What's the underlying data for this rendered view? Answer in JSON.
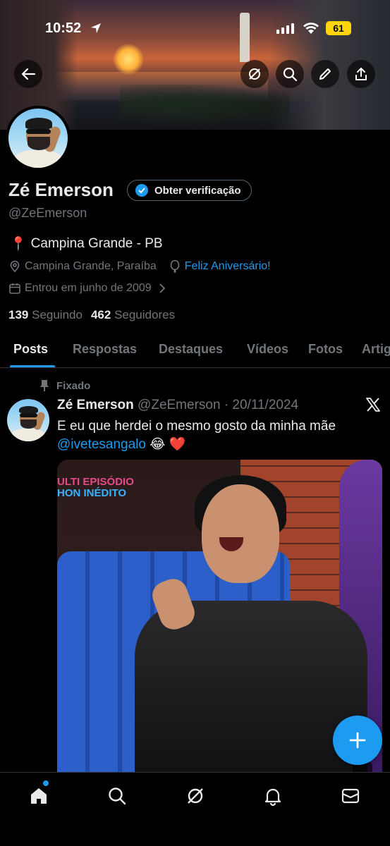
{
  "status_bar": {
    "time": "10:52",
    "battery": "61"
  },
  "profile": {
    "name": "Zé Emerson",
    "verify_label": "Obter verificação",
    "handle": "@ZeEmerson",
    "bio_emoji": "📍",
    "bio": "Campina Grande - PB",
    "location": "Campina Grande, Paraíba",
    "birthday": "Feliz Aniversário!",
    "joined": "Entrou em junho de 2009",
    "following_count": "139",
    "following_label": "Seguindo",
    "followers_count": "462",
    "followers_label": "Seguidores"
  },
  "tabs": [
    "Posts",
    "Respostas",
    "Destaques",
    "Vídeos",
    "Fotos",
    "Artigos"
  ],
  "active_tab": "Posts",
  "post": {
    "pinned_label": "Fixado",
    "author": "Zé Emerson",
    "handle_date": "@ZeEmerson · 20/11/2024",
    "text_line1": "E eu que herdei o mesmo gosto da minha mãe",
    "mention": "@ivetesangalo",
    "emojis": " 😂 ❤️",
    "media_tag_line1": "ULTI  EPISÓDIO",
    "media_tag_line2": "HON  INÉDITO"
  },
  "colors": {
    "accent": "#1d9bf0",
    "muted": "#71767b",
    "text": "#e7e9ea",
    "battery": "#ffd60a"
  },
  "icons": [
    "back-arrow-icon",
    "grok-icon",
    "search-icon",
    "edit-pen-icon",
    "share-icon",
    "verified-badge-icon",
    "location-pin-icon",
    "balloon-icon",
    "calendar-icon",
    "chevron-right-icon",
    "pin-icon",
    "x-logo-icon",
    "plus-icon",
    "home-icon",
    "search-icon",
    "grok-icon",
    "bell-icon",
    "mail-icon"
  ]
}
